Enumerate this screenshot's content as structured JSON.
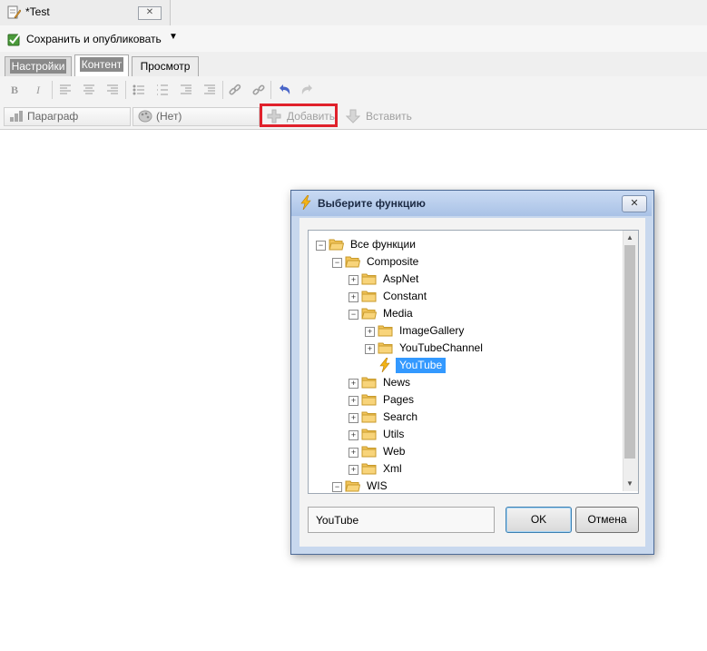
{
  "doc_tab": {
    "title": "*Test",
    "close_icon": "close-icon"
  },
  "publish": {
    "label": "Сохранить и опубликовать",
    "arrow": "▼"
  },
  "mode_tabs": [
    {
      "label": "Настройки"
    },
    {
      "label": "Контент"
    },
    {
      "label": "Просмотр"
    }
  ],
  "format_toolbar": {
    "bold": "B",
    "italic": "I"
  },
  "toolbar2": {
    "paragraph": "Параграф",
    "style": "(Нет)",
    "add": "Добавить",
    "insert": "Вставить"
  },
  "dialog": {
    "title": "Выберите функцию",
    "tree": {
      "root": "Все функции",
      "composite": "Composite",
      "aspnet": "AspNet",
      "constant": "Constant",
      "media": "Media",
      "imagegallery": "ImageGallery",
      "youtubechannel": "YouTubeChannel",
      "youtube": "YouTube",
      "news": "News",
      "pages": "Pages",
      "search": "Search",
      "utils": "Utils",
      "web": "Web",
      "xml": "Xml",
      "wis": "WIS"
    },
    "selected_value": "YouTube",
    "ok_label": "OK",
    "cancel_label": "Отмена"
  },
  "colors": {
    "highlight": "#e0212b",
    "selection": "#3399ff",
    "folder": "#f2c45a"
  }
}
